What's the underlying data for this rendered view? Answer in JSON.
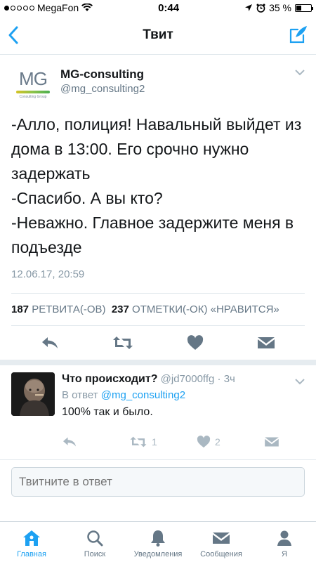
{
  "status_bar": {
    "carrier": "MegaFon",
    "time": "0:44",
    "battery": "35 %",
    "battery_level": 0.35
  },
  "nav": {
    "title": "Твит"
  },
  "tweet": {
    "logo_text": "MG",
    "logo_sub": "Consulting Group",
    "author_name": "MG-consulting",
    "author_handle": "@mg_consulting2",
    "text": "-Алло, полиция! Навальный выйдет из дома в 13:00. Его срочно нужно задержать\n-Спасибо. А вы кто?\n-Неважно. Главное задержите меня в подъезде",
    "timestamp": "12.06.17, 20:59",
    "retweet_count": "187",
    "retweet_label": "РЕТВИТА(-ОВ)",
    "like_count": "237",
    "like_label": "ОТМЕТКИ(-ОК) «НРАВИТСЯ»"
  },
  "reply": {
    "name": "Что происходит?",
    "handle": "@jd7000ffg",
    "separator": "·",
    "time": "3ч",
    "reply_to_prefix": "В ответ",
    "reply_to_handle": "@mg_consulting2",
    "text": "100% так и было.",
    "retweet_count": "1",
    "like_count": "2"
  },
  "compose": {
    "placeholder": "Твитните в ответ"
  },
  "tabs": [
    {
      "label": "Главная",
      "icon": "home-icon",
      "active": true
    },
    {
      "label": "Поиск",
      "icon": "search-icon"
    },
    {
      "label": "Уведомления",
      "icon": "bell-icon"
    },
    {
      "label": "Сообщения",
      "icon": "envelope-icon"
    },
    {
      "label": "Я",
      "icon": "profile-icon"
    }
  ],
  "colors": {
    "accent": "#1da1f2",
    "muted": "#8899a6",
    "icon_gray": "#657786"
  }
}
